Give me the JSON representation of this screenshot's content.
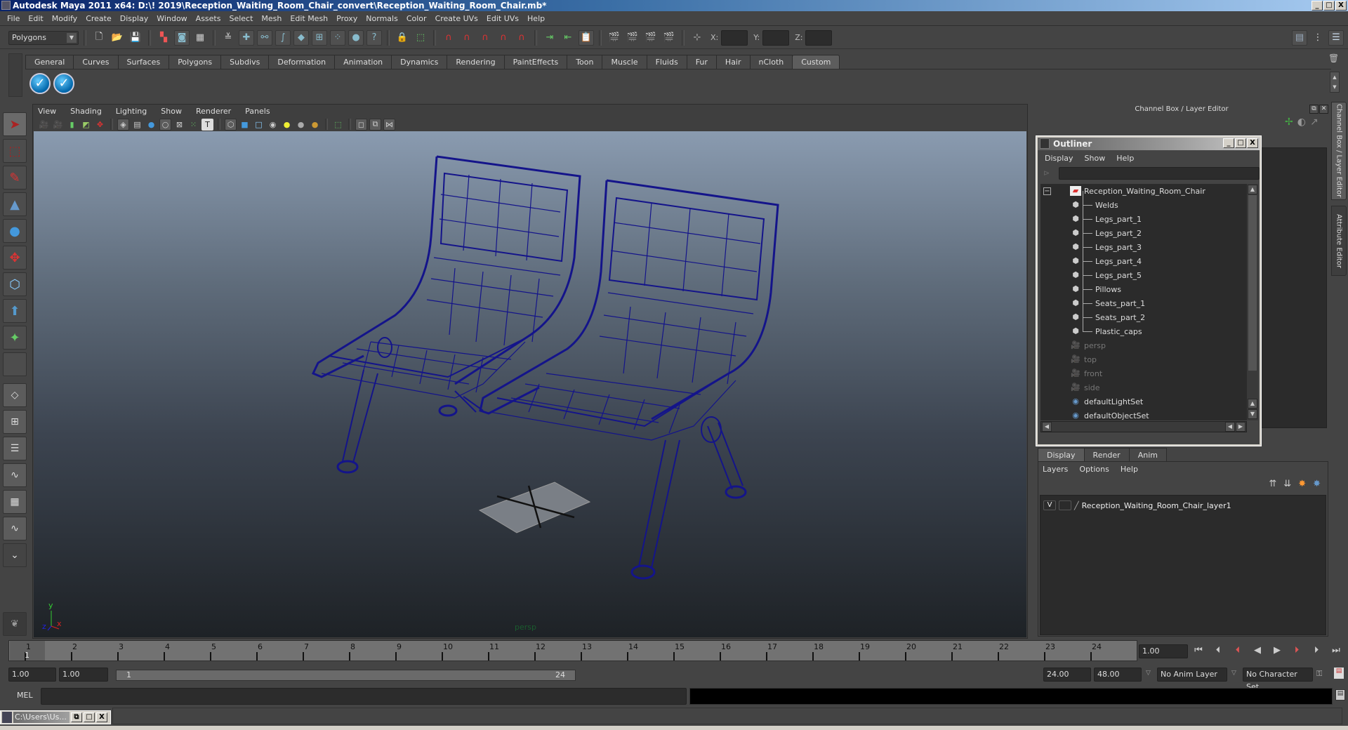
{
  "window": {
    "title": "Autodesk Maya 2011 x64: D:\\! 2019\\Reception_Waiting_Room_Chair_convert\\Reception_Waiting_Room_Chair.mb*",
    "controls": {
      "minimize": "_",
      "maximize": "□",
      "close": "X"
    }
  },
  "menubar": [
    "File",
    "Edit",
    "Modify",
    "Create",
    "Display",
    "Window",
    "Assets",
    "Select",
    "Mesh",
    "Edit Mesh",
    "Proxy",
    "Normals",
    "Color",
    "Create UVs",
    "Edit UVs",
    "Help"
  ],
  "statusline": {
    "menuset": "Polygons",
    "icons": [
      "new-scene-icon",
      "open-scene-icon",
      "save-scene-icon",
      "select-by-hierarchy-icon",
      "select-by-object-icon",
      "select-by-component-icon",
      "lock-selection-icon",
      "snap-grid-icon",
      "snap-curve-icon",
      "snap-point-icon",
      "snap-view-plane-icon",
      "snap-live-icon",
      "input-ops-icon",
      "output-ops-icon",
      "history-icon",
      "render-view-icon",
      "render-icon",
      "ipr-render-icon",
      "render-settings-icon"
    ],
    "xyz": {
      "x_label": "X:",
      "y_label": "Y:",
      "z_label": "Z:",
      "x": "",
      "y": "",
      "z": ""
    }
  },
  "shelf": {
    "tabs": [
      "General",
      "Curves",
      "Surfaces",
      "Polygons",
      "Subdivs",
      "Deformation",
      "Animation",
      "Dynamics",
      "Rendering",
      "PaintEffects",
      "Toon",
      "Muscle",
      "Fluids",
      "Fur",
      "Hair",
      "nCloth",
      "Custom"
    ],
    "active_tab": "Custom",
    "items": [
      "check-icon",
      "check-icon"
    ]
  },
  "viewport": {
    "menu": [
      "View",
      "Shading",
      "Lighting",
      "Show",
      "Renderer",
      "Panels"
    ],
    "camera_label": "persp",
    "axis": {
      "x": "x",
      "y": "y",
      "z": "z"
    }
  },
  "channel_box": {
    "title": "Channel Box / Layer Editor",
    "side_tabs": [
      "Channel Box / Layer Editor",
      "Attribute Editor"
    ]
  },
  "outliner": {
    "title": "Outliner",
    "menu": [
      "Display",
      "Show",
      "Help"
    ],
    "filter": "",
    "root": "Reception_Waiting_Room_Chair",
    "children": [
      "Welds",
      "Legs_part_1",
      "Legs_part_2",
      "Legs_part_3",
      "Legs_part_4",
      "Legs_part_5",
      "Pillows",
      "Seats_part_1",
      "Seats_part_2",
      "Plastic_caps"
    ],
    "cameras": [
      "persp",
      "top",
      "front",
      "side"
    ],
    "sets": [
      "defaultLightSet",
      "defaultObjectSet"
    ]
  },
  "layer_editor": {
    "tabs": [
      "Display",
      "Render",
      "Anim"
    ],
    "active_tab": "Display",
    "menu": [
      "Layers",
      "Options",
      "Help"
    ],
    "layers": [
      {
        "visible": "V",
        "name": "Reception_Waiting_Room_Chair_layer1"
      }
    ]
  },
  "timeslider": {
    "ticks": [
      1,
      2,
      3,
      4,
      5,
      6,
      7,
      8,
      9,
      10,
      11,
      12,
      13,
      14,
      15,
      16,
      17,
      18,
      19,
      20,
      21,
      22,
      23,
      24
    ],
    "current_frame_marker": "1",
    "current_frame": "1.00"
  },
  "range": {
    "start": "1.00",
    "playback_start": "1.00",
    "slider_start": "1",
    "slider_end": "24",
    "playback_end": "24.00",
    "end": "48.00",
    "anim_layer": "No Anim Layer",
    "character_set": "No Character Set"
  },
  "command_line": {
    "label": "MEL",
    "input": "",
    "result": ""
  },
  "minimized_window": {
    "title": "C:\\Users\\Us..."
  }
}
